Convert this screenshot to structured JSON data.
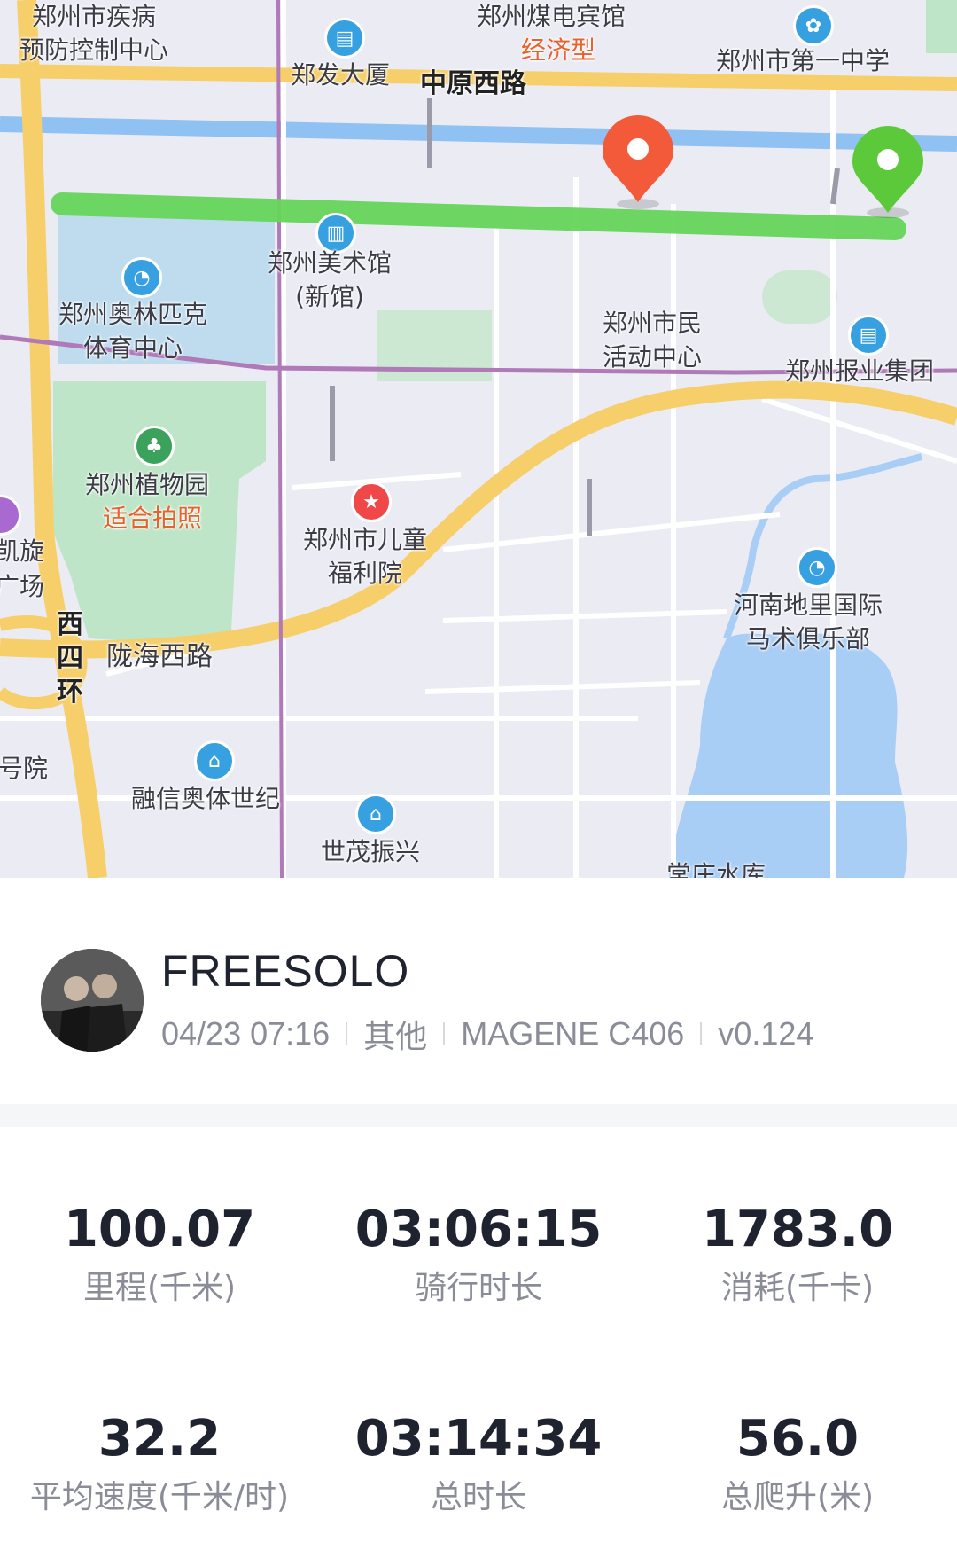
{
  "map": {
    "labels": {
      "cdc": "郑州市疾病\n预防控制中心",
      "hotel": "郑州煤电宾馆",
      "hotel_tag": "经济型",
      "school": "郑州市第一中学",
      "zhengfa": "郑发大厦",
      "road_zhongyuan": "中原西路",
      "art": "郑州美术馆\n(新馆)",
      "olympic": "郑州奥林匹克\n体育中心",
      "civic": "郑州市民\n活动中心",
      "newspaper": "郑州报业集团",
      "botanic": "郑州植物园",
      "botanic_tag": "适合拍照",
      "kaixuan": "凯旋\n广场",
      "children": "郑州市儿童\n福利院",
      "equestrian": "河南地里国际\n马术俱乐部",
      "west4ring": "西\n四\n环",
      "road_longhai": "陇海西路",
      "haoyuan": "号院",
      "rongxin": "融信奥体世纪",
      "shimao": "世茂振兴",
      "reservoir": "常庄水库"
    }
  },
  "profile": {
    "username": "FREESOLO",
    "datetime": "04/23 07:16",
    "category": "其他",
    "device": "MAGENE C406",
    "version": "v0.124"
  },
  "stats": [
    {
      "value": "100.07",
      "label": "里程(千米)"
    },
    {
      "value": "03:06:15",
      "label": "骑行时长"
    },
    {
      "value": "1783.0",
      "label": "消耗(千卡)"
    },
    {
      "value": "32.2",
      "label": "平均速度(千米/时)"
    },
    {
      "value": "03:14:34",
      "label": "总时长"
    },
    {
      "value": "56.0",
      "label": "总爬升(米)"
    }
  ],
  "colors": {
    "route": "#66d55a",
    "start_pin": "#5cc93a",
    "end_pin": "#f35a3a"
  }
}
